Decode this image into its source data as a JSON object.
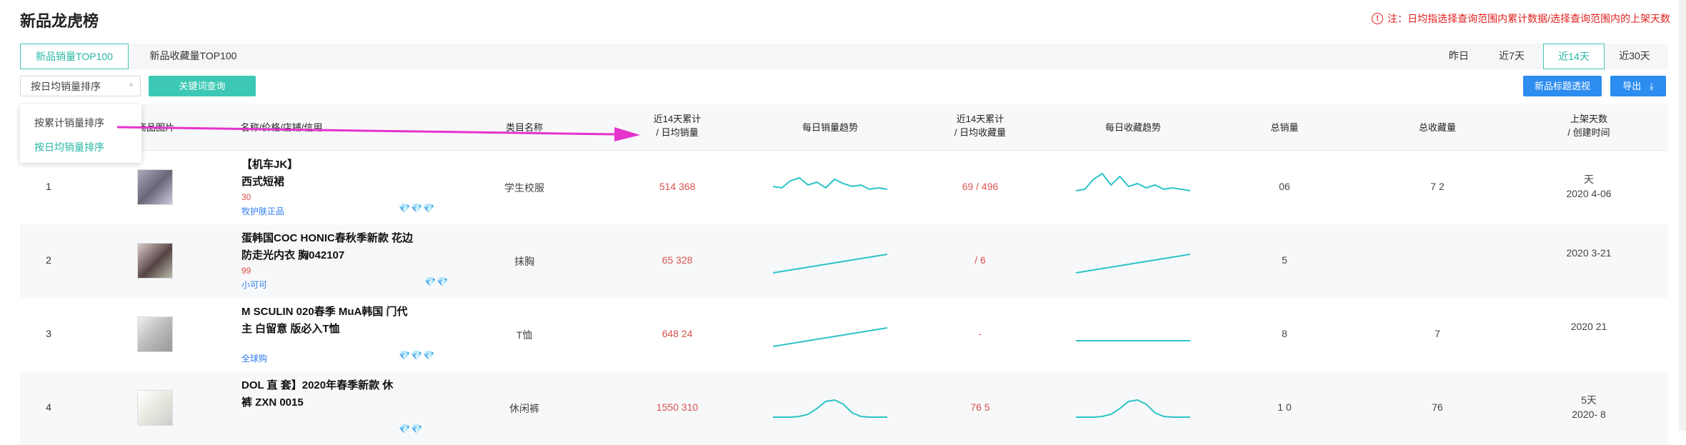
{
  "page": {
    "title": "新品龙虎榜",
    "notice": "注：日均指选择查询范围内累计数据/选择查询范围内的上架天数"
  },
  "tabs": [
    {
      "label": "新品销量TOP100",
      "active": true
    },
    {
      "label": "新品收藏量TOP100",
      "active": false
    }
  ],
  "ranges": [
    {
      "label": "昨日",
      "active": false
    },
    {
      "label": "近7天",
      "active": false
    },
    {
      "label": "近14天",
      "active": true
    },
    {
      "label": "近30天",
      "active": false
    }
  ],
  "toolbar": {
    "sort_selected": "按日均销量排序",
    "keyword_btn": "关键词查询",
    "title_btn": "新品标题透视",
    "export_btn": "导出"
  },
  "dropdown": {
    "options": [
      {
        "label": "按累计销量排序",
        "selected": false
      },
      {
        "label": "按日均销量排序",
        "selected": true
      }
    ]
  },
  "columns": {
    "image": "商品图片",
    "name": "名称/价格/店铺/信用",
    "category": "类目名称",
    "sales_l1": "近14天累计",
    "sales_l2": "/ 日均销量",
    "sales_trend": "每日销量趋势",
    "fav_l1": "近14天累计",
    "fav_l2": "/ 日均收藏量",
    "fav_trend": "每日收藏趋势",
    "total_sales": "总销量",
    "total_fav": "总收藏量",
    "days_l1": "上架天数",
    "days_l2": "/ 创建时间"
  },
  "rows": [
    {
      "rank": "1",
      "name_l1": "【机车JK】",
      "name_l2": "西式短裙",
      "price": "30",
      "shop": "牧护肤正品",
      "credit": "💎💎💎",
      "category": "学生校服",
      "sales": "514 368",
      "fav": "69 / 496",
      "total_sales": "06",
      "total_fav": "7 2",
      "days_l1": "天",
      "days_l2": "2020 4-06",
      "sales_spark": [
        20,
        22,
        12,
        8,
        18,
        14,
        22,
        10,
        16,
        20,
        18,
        24,
        22,
        24
      ],
      "fav_spark": [
        26,
        24,
        10,
        2,
        18,
        6,
        20,
        16,
        22,
        18,
        24,
        22,
        24,
        26
      ]
    },
    {
      "rank": "2",
      "name_l1": "蛋韩国COC HONIC春秋季新款 花边",
      "name_l2": "防走光内衣 胸042107",
      "price": "99",
      "shop": "小可可",
      "credit": "💎💎",
      "category": "抹胸",
      "sales": "65 328",
      "fav": "/ 6",
      "total_sales": "5",
      "total_fav": "",
      "days_l1": "",
      "days_l2": "2020 3-21",
      "sales_spark": [
        38,
        36,
        34,
        32,
        30,
        28,
        26,
        24,
        22,
        20,
        18,
        16,
        14,
        12
      ],
      "fav_spark": [
        38,
        36,
        34,
        32,
        30,
        28,
        26,
        24,
        22,
        20,
        18,
        16,
        14,
        12
      ]
    },
    {
      "rank": "3",
      "name_l1": "M SCULIN 020春季 MuA韩国 门代",
      "name_l2": "主 白留意 版必入T恤",
      "price": "",
      "shop": "全球购",
      "credit": "💎💎💎",
      "category": "T恤",
      "sales": "648 24",
      "fav": "-",
      "total_sales": "8",
      "total_fav": "7",
      "days_l1": "",
      "days_l2": "2020 21",
      "sales_spark": [
        38,
        36,
        34,
        32,
        30,
        28,
        26,
        24,
        22,
        20,
        18,
        16,
        14,
        12
      ],
      "fav_spark": [
        30,
        30,
        30,
        30,
        30,
        30,
        30,
        30,
        30,
        30,
        30,
        30,
        30,
        30
      ]
    },
    {
      "rank": "4",
      "name_l1": "DOL 直 套】2020年春季新款 休",
      "name_l2": "裤 ZXN 0015",
      "price": "",
      "shop": "",
      "credit": "💎💎",
      "category": "休闲裤",
      "sales": "1550 310",
      "fav": "76 5",
      "total_sales": "1 0",
      "total_fav": "76",
      "days_l1": "5天",
      "days_l2": "2020- 8",
      "sales_spark": [
        34,
        34,
        34,
        33,
        30,
        22,
        12,
        10,
        16,
        28,
        33,
        34,
        34,
        34
      ],
      "fav_spark": [
        34,
        34,
        34,
        33,
        30,
        22,
        12,
        10,
        16,
        28,
        33,
        34,
        34,
        34
      ]
    }
  ],
  "colors": {
    "accent": "#3cc8b4",
    "blue": "#2d8cf0",
    "red": "#d9534f",
    "spark": "#2bc4c8",
    "arrow": "#e633cc"
  }
}
